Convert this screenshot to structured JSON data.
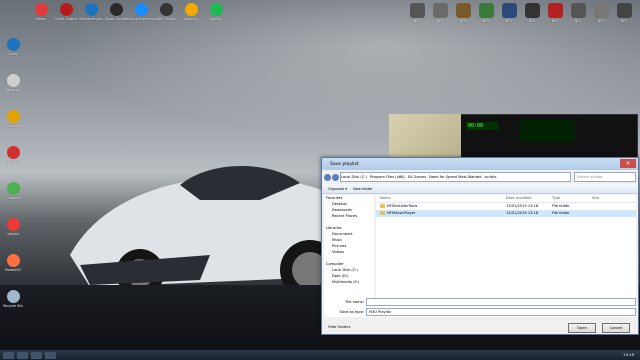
{
  "desktop": {
    "top_icons": [
      {
        "label": "Steam",
        "color": "#e23b3b"
      },
      {
        "label": "Cheat Engine",
        "color": "#b71c1c"
      },
      {
        "label": "Malwarebytes",
        "color": "#1e73be"
      },
      {
        "label": "Razer Cortex",
        "color": "#2a2a2a"
      },
      {
        "label": "GeForce Experience",
        "color": "#1a8cff"
      },
      {
        "label": "OBS Studio",
        "color": "#333333"
      },
      {
        "label": "Audacity",
        "color": "#f2a900"
      },
      {
        "label": "Spotify",
        "color": "#1db954"
      }
    ],
    "left_icons": [
      {
        "label": "Uplay",
        "color": "#1e73be"
      },
      {
        "label": "Winamp",
        "color": "#cfcfcf"
      },
      {
        "label": "Ultimaker",
        "color": "#e1a300"
      },
      {
        "label": "Opera",
        "color": "#d32f2f"
      },
      {
        "label": "Chrome",
        "color": "#4caf50"
      },
      {
        "label": "Vivaldi",
        "color": "#ef3939"
      },
      {
        "label": "PowerISO",
        "color": "#ff7043"
      },
      {
        "label": "Recycle Bin",
        "color": "#9fb7cf"
      }
    ],
    "right_icons": [
      {
        "label": "NFS",
        "color": "#555"
      },
      {
        "label": "NFS",
        "color": "#6a6a6a"
      },
      {
        "label": "NFS",
        "color": "#7a5a2b"
      },
      {
        "label": "NFS",
        "color": "#3a7a3a"
      },
      {
        "label": "NFS",
        "color": "#2b4a7a"
      },
      {
        "label": "NFS",
        "color": "#333"
      },
      {
        "label": "NFS",
        "color": "#b22222"
      },
      {
        "label": "NFS",
        "color": "#555"
      },
      {
        "label": "NFS",
        "color": "#777"
      },
      {
        "label": "NFS",
        "color": "#444"
      }
    ]
  },
  "player": {
    "time": "00:00"
  },
  "dialog": {
    "title": "Save playlist",
    "close": "×",
    "breadcrumb": [
      "Local Disk (C:)",
      "Program Files (x86)",
      "EA Games",
      "Need for Speed Most Wanted",
      "scripts"
    ],
    "search_placeholder": "Search scripts",
    "organize": "Organize ▾",
    "new_folder": "New folder",
    "nav_items": [
      "Favorites",
      "Desktop",
      "Downloads",
      "Recent Places",
      "",
      "Libraries",
      "Documents",
      "Music",
      "Pictures",
      "Videos",
      "",
      "Computer",
      "Local Disk (C:)",
      "Data (D:)",
      "Multimedia (E:)"
    ],
    "columns": [
      "Name",
      "Date modified",
      "Type",
      "Size"
    ],
    "files": [
      {
        "name": "NFSInstallerTools",
        "date": "13/01/2019 13:18",
        "type": "File folder",
        "size": ""
      },
      {
        "name": "NFSMusicPlayer",
        "date": "13/01/2019 13:18",
        "type": "File folder",
        "size": ""
      }
    ],
    "file_name_label": "File name:",
    "file_name_value": "",
    "save_type_label": "Save as type:",
    "save_type_value": "M3U Playlist",
    "hide_folders": "Hide Folders",
    "open_button": "Open",
    "cancel_button": "Cancel"
  },
  "taskbar": {
    "clock": "13:19"
  }
}
